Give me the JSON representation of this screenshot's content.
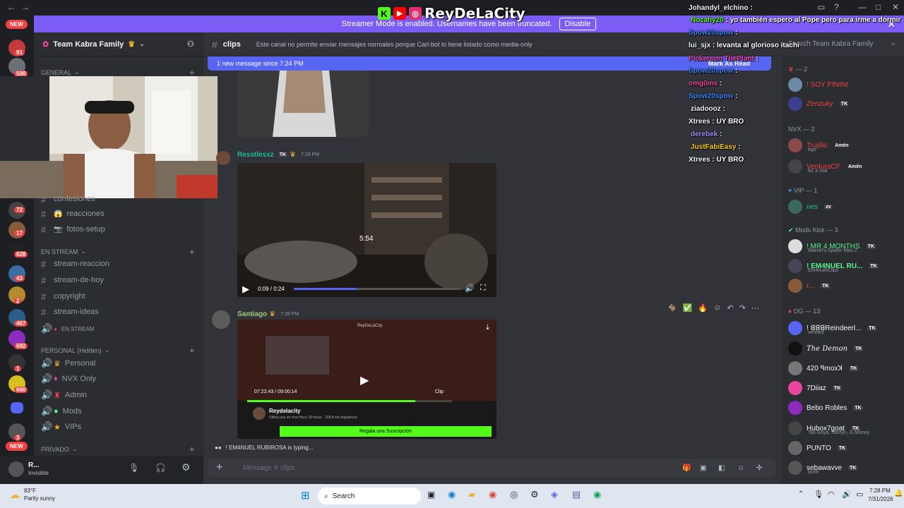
{
  "brand": {
    "name": "ReyDeLaCity",
    "k_letter": "K",
    "k_color": "#53fc18",
    "yt_color": "#ff0000",
    "ig_color": "#e1306c"
  },
  "banner": {
    "text": "Streamer Mode is enabled. Usernames have been truncated.",
    "button": "Disable"
  },
  "rail": {
    "new_top": "NEW",
    "new_bottom": "NEW",
    "badges": [
      "91",
      "500",
      "72",
      "17",
      "628",
      "43",
      "2",
      "467",
      "692",
      "1",
      "660",
      "3"
    ]
  },
  "server": {
    "name": "Team Kabra Family"
  },
  "categories": {
    "general": "GENERAL",
    "en_stream": "EN STREAM",
    "personal": "PERSONAL (Hidden)",
    "privado": "PRIVADO"
  },
  "channels": {
    "confesiones": "confesiones",
    "reacciones": "reacciones",
    "fotos_setup": "fotos-setup",
    "stream_reaccion": "stream-reaccion",
    "stream_de_hoy": "stream-de-hoy",
    "copyright": "copyright",
    "stream_ideas": "stream-ideas",
    "en_stream_voice": "EN STREAM",
    "personal": "Personal",
    "nvx_only": "NVX Only",
    "admin": "Admin",
    "mods": "Mods",
    "vips": "VIPs"
  },
  "user": {
    "name": "R...",
    "status": "Invisible"
  },
  "chat": {
    "channel": "clips",
    "topic": "Este canal no permite enviar mensajes normales porque Carl-bot lo tiene listado como media-only",
    "new_messages": "1 new message since 7:24 PM",
    "mark_read": "Mark As Read",
    "messages": [
      {
        "author": "Resstlesxz",
        "time": "7:28 PM",
        "color": "#1abc9c",
        "video": {
          "duration": "5:54",
          "progress": "0:09 / 0:24",
          "fraction": 0.375
        }
      },
      {
        "author": "Santiago",
        "time": "7:28 PM",
        "color": "#a0c97a",
        "embed": {
          "player_time": "07:22:43 / 09:00:14",
          "clip_label": "Clip",
          "channel_name": "Reydelacity",
          "channel_sub": "Última vez en vivo Hace 18 horas · 158,8 mil seguidores",
          "subscribe": "Regala una Suscripción",
          "brand": "ReyDeLaCity",
          "progress": 0.82
        }
      }
    ],
    "typing": "! EM4NUEL RUBIROSA is typing...",
    "composer_placeholder": "Message # ",
    "composer_channel": "clips"
  },
  "search": {
    "placeholder": "Search Team Kabra Family"
  },
  "members": {
    "groups": [
      {
        "label": "— 2",
        "top": "x"
      },
      {
        "label": "NVX — 2"
      },
      {
        "label": "VIP — 1"
      },
      {
        "label": "Mods Kick — 3"
      },
      {
        "label": "OG — 13"
      }
    ],
    "list": [
      {
        "name": "! SOY PININI",
        "color": "#f23f42"
      },
      {
        "name": "Zenzuky",
        "color": "#f23f42",
        "tk": "TK"
      },
      {
        "name": "Trujillo",
        "color": "#f23f42",
        "role": "Amén",
        "sub": "ego"
      },
      {
        "name": "VenturaCF",
        "color": "#f23f42",
        "role": "Amén",
        "sub": "lol, k mal"
      },
      {
        "name": "nes",
        "color": "#1abc9c",
        "tag": "zv"
      },
      {
        "name": "! MR 4 MONTHS",
        "color": "#57f287",
        "tk": "TK",
        "sub": "Marvel's Spider-Man 2"
      },
      {
        "name": "! EM4NUEL RU...",
        "color": "#57f287",
        "tk": "TK",
        "sub": "Em4nuelClips"
      },
      {
        "name": "r...",
        "color": "#f23f42",
        "tk": "TK"
      },
      {
        "name": "! ꓭꓭꓭReindeerl...",
        "color": "#f2f3f5",
        "tk": "TK",
        "sub": "verified"
      },
      {
        "name": "The Demon",
        "color": "#f2f3f5",
        "tk": "TK"
      },
      {
        "name": "420 ꟼmoxꓘ",
        "color": "#f2f3f5",
        "tk": "TK"
      },
      {
        "name": "7Diiaz",
        "color": "#f2f3f5",
        "tk": "TK"
      },
      {
        "name": "Bebo Robles",
        "color": "#f2f3f5",
        "tk": "TK"
      },
      {
        "name": "Hubox7goat",
        "color": "#f2f3f5",
        "tk": "TK",
        "sub": "Tali Goya, Sterlyn, G Money"
      },
      {
        "name": "PUNTO",
        "color": "#f2f3f5",
        "tk": "TK"
      },
      {
        "name": "sebawavve",
        "color": "#f2f3f5",
        "tk": "TK",
        "sub": "buhh"
      }
    ]
  },
  "stream_chat": [
    {
      "user": "Johandyl_elchino",
      "msg": ":",
      "color": "#f2f3f5"
    },
    {
      "user": "Nozahy20",
      "msg": ": yo también espero al Pope pero para irme a dormir",
      "color": "#53fc18"
    },
    {
      "user": "Spow20spow",
      "msg": ":",
      "color": "#3b82f6"
    },
    {
      "user": "lui_sjx",
      "msg": ": levanta al glorioso itachi",
      "color": "#f2f3f5"
    },
    {
      "user": "Pickerson ThePlant",
      "msg": ":",
      "color": "#ec4899"
    },
    {
      "user": "Spow20spow",
      "msg": ":",
      "color": "#3b82f6"
    },
    {
      "user": "omg0ms",
      "msg": ":",
      "color": "#ec4899"
    },
    {
      "user": "Spow20spow",
      "msg": ":",
      "color": "#3b82f6"
    },
    {
      "user": "ziadoooz",
      "msg": ":",
      "color": "#f2f3f5"
    },
    {
      "user": "Xtrees",
      "msg": ": UY BRO",
      "color": "#f2f3f5"
    },
    {
      "user": "derebek",
      "msg": ":",
      "color": "#a78bfa"
    },
    {
      "user": "JustFabiEasy",
      "msg": ":",
      "color": "#facc15"
    },
    {
      "user": "Xtrees",
      "msg": ": UY BRO",
      "color": "#f2f3f5"
    }
  ],
  "taskbar": {
    "weather_temp": "83°F",
    "weather_desc": "Partly sunny",
    "search": "Search",
    "time": "7:28 PM",
    "date": "7/31/2026"
  }
}
